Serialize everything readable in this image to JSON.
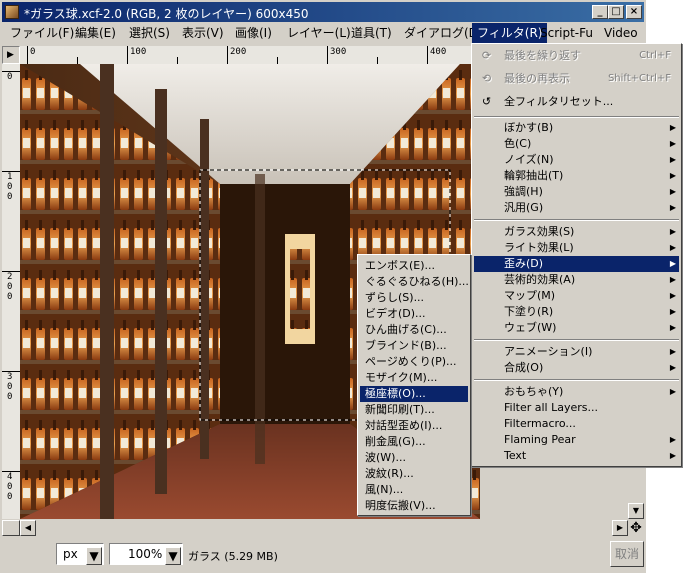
{
  "window": {
    "title": "*ガラス球.xcf-2.0 (RGB, 2 枚のレイヤー) 600x450",
    "min_glyph": "_",
    "max_glyph": "□",
    "close_glyph": "×"
  },
  "menubar": {
    "items": [
      {
        "label": "ファイル(F)"
      },
      {
        "label": "編集(E)"
      },
      {
        "label": "選択(S)"
      },
      {
        "label": "表示(V)"
      },
      {
        "label": "画像(I)"
      },
      {
        "label": "レイヤー(L)"
      },
      {
        "label": "道具(T)"
      },
      {
        "label": "ダイアログ(D)"
      },
      {
        "label": "フィルタ(R)"
      },
      {
        "label": "Script-Fu"
      },
      {
        "label": "Video"
      }
    ]
  },
  "rulers": {
    "corner_glyph": "▶",
    "h_labels": [
      "0",
      "100",
      "200",
      "300",
      "400"
    ],
    "v_labels": [
      "0",
      "100",
      "200",
      "300",
      "400"
    ]
  },
  "filters_menu": {
    "top_items": [
      {
        "label": "最後を繰り返す",
        "shortcut": "Ctrl+F",
        "icon": "repeat-last-icon",
        "glyph": "⟳",
        "disabled": true
      },
      {
        "label": "最後の再表示",
        "shortcut": "Shift+Ctrl+F",
        "icon": "reshow-last-icon",
        "glyph": "⟲",
        "disabled": true
      },
      {
        "label": "全フィルタリセット...",
        "shortcut": "",
        "icon": "reset-all-icon",
        "glyph": "↺",
        "disabled": false
      }
    ],
    "group1": [
      "ぼかす(B)",
      "色(C)",
      "ノイズ(N)",
      "輪郭抽出(T)",
      "強調(H)",
      "汎用(G)"
    ],
    "group2": [
      "ガラス効果(S)",
      "ライト効果(L)",
      "歪み(D)",
      "芸術的効果(A)",
      "マップ(M)",
      "下塗り(R)",
      "ウェブ(W)"
    ],
    "group3": [
      "アニメーション(I)",
      "合成(O)"
    ],
    "group4": [
      {
        "label": "おもちゃ(Y)",
        "submenu": true
      },
      {
        "label": "Filter all Layers...",
        "submenu": false
      },
      {
        "label": "Filtermacro...",
        "submenu": false
      },
      {
        "label": "Flaming Pear",
        "submenu": true
      },
      {
        "label": "Text",
        "submenu": true
      }
    ]
  },
  "distort_menu": {
    "items": [
      "エンボス(E)...",
      "ぐるぐるひねる(H)...",
      "ずらし(S)...",
      "ビデオ(D)...",
      "ひん曲げる(C)...",
      "ブラインド(B)...",
      "ページめくり(P)...",
      "モザイク(M)...",
      "極座標(O)...",
      "新聞印刷(T)...",
      "対話型歪め(I)...",
      "削金風(G)...",
      "波(W)...",
      "波紋(R)...",
      "風(N)...",
      "明度伝搬(V)..."
    ],
    "highlighted": 8
  },
  "statusbar": {
    "unit": "px",
    "zoom": "100%",
    "info": "ガラス (5.29 MB)",
    "cancel": "取消"
  },
  "glyphs": {
    "dropdown": "▼",
    "arrow_up": "▲",
    "arrow_down": "▼",
    "arrow_left": "◀",
    "arrow_right": "▶",
    "navigate": "✥",
    "submenu": "▶"
  }
}
